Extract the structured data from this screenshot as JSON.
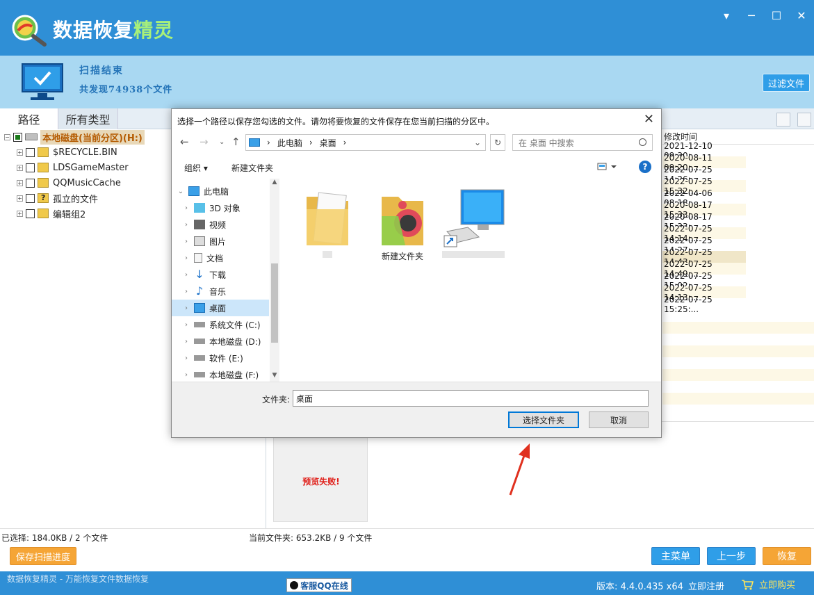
{
  "app": {
    "title_main": "数据恢复",
    "title_accent": "精灵",
    "window_buttons": [
      "▾",
      "─",
      "☐",
      "✕"
    ]
  },
  "status": {
    "scan_title": "扫描结束",
    "scan_count": "共发现74938个文件",
    "filter_button": "过滤文件"
  },
  "tabs": [
    "路径",
    "所有类型"
  ],
  "tree": {
    "root": "本地磁盘(当前分区)(H:)",
    "items": [
      "$RECYCLE.BIN",
      "LDSGameMaster",
      "QQMusicCache",
      "孤立的文件",
      "编辑组2"
    ]
  },
  "list": {
    "column_header": "修改时间",
    "dates": [
      "2021-12-10 09:30:...",
      "2020-08-11 09:20:...",
      "2022-07-25 14:26:...",
      "2022-07-25 15:32:...",
      "2022-04-06 08:18:...",
      "2020-08-17 15:33:...",
      "2020-08-17 15:33:...",
      "2022-07-25 14:14:...",
      "2022-07-25 14:27:...",
      "2022-07-25 14:43:...",
      "2022-07-25 14:49:...",
      "2022-07-25 15:02:...",
      "2022-07-25 14:13:...",
      "2022-07-25 15:25:..."
    ]
  },
  "preview": {
    "fail_text": "预览失败!"
  },
  "bottom": {
    "selected_info": "已选择: 184.0KB / 2 个文件",
    "current_info": "当前文件夹: 653.2KB / 9 个文件",
    "save_progress": "保存扫描进度",
    "main_menu": "主菜单",
    "prev_step": "上一步",
    "recover": "恢复"
  },
  "footer": {
    "left_text": "数据恢复精灵 - 万能恢复文件数据恢复",
    "qq": "客服QQ在线",
    "version": "版本: 4.4.0.435 x64",
    "register": "立即注册",
    "buy": "立即购买"
  },
  "dialog": {
    "title": "选择一个路径以保存您勾选的文件。请勿将要恢复的文件保存在您当前扫描的分区中。",
    "close": "✕",
    "breadcrumb": [
      "此电脑",
      "›",
      "桌面",
      "›"
    ],
    "search_placeholder": "在 桌面 中搜索",
    "organize": "组织 ▾",
    "new_folder": "新建文件夹",
    "help": "?",
    "nav_items": [
      "此电脑",
      "3D 对象",
      "视频",
      "图片",
      "文档",
      "下载",
      "音乐",
      "桌面",
      "系统文件 (C:)",
      "本地磁盘 (D:)",
      "软件 (E:)",
      "本地磁盘 (F:)"
    ],
    "files": [
      "新建文件夹"
    ],
    "folder_label": "文件夹:",
    "folder_value": "桌面",
    "select_button": "选择文件夹",
    "cancel_button": "取消"
  },
  "colors": {
    "titlebar": "#2f8fd6",
    "accent_green": "#a8f07a",
    "orange": "#f5a536",
    "selection": "#cce6fa"
  }
}
